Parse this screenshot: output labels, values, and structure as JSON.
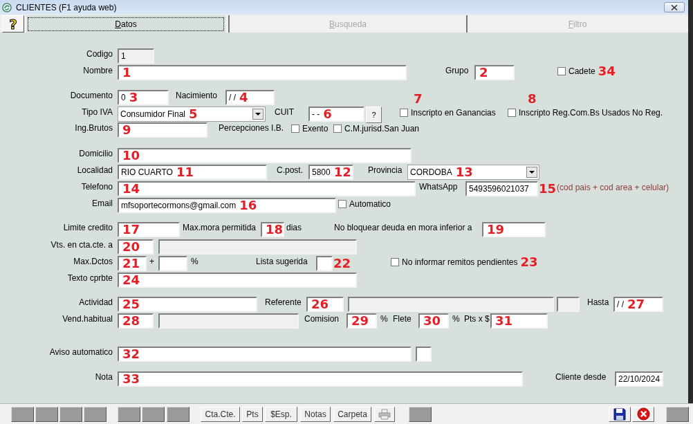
{
  "window": {
    "title": "CLIENTES (F1 ayuda web)"
  },
  "help_button": "?",
  "tabs": [
    {
      "label": "Datos",
      "selected": true,
      "disabled": false
    },
    {
      "label": "Busqueda",
      "selected": false,
      "disabled": true
    },
    {
      "label": "Filtro",
      "selected": false,
      "disabled": true
    }
  ],
  "rows": [
    {
      "items": [
        {
          "kind": "label",
          "text": "Codigo"
        },
        {
          "kind": "field",
          "value": "1",
          "readonly": true
        }
      ]
    },
    {
      "items": [
        {
          "kind": "label",
          "text": "Nombre"
        },
        {
          "kind": "field",
          "marker": "1",
          "readonly": false
        },
        {
          "kind": "label",
          "text": "Grupo"
        },
        {
          "kind": "field",
          "marker": "2",
          "readonly": false
        },
        {
          "kind": "checkbox",
          "text": "Cadete",
          "checked": false,
          "marker": "34"
        }
      ]
    },
    {
      "items": [
        {
          "kind": "label",
          "text": "Documento"
        },
        {
          "kind": "field",
          "marker": "3",
          "value": "0",
          "readonly": false
        },
        {
          "kind": "label",
          "text": "Nacimiento"
        },
        {
          "kind": "field",
          "value": "/ /",
          "marker": "4",
          "readonly": false
        }
      ]
    },
    {
      "items": [
        {
          "kind": "label",
          "text": "Tipo IVA"
        },
        {
          "kind": "select",
          "value": "Consumidor Final",
          "marker": "5"
        },
        {
          "kind": "label",
          "text": "CUIT"
        },
        {
          "kind": "field",
          "value": "- -",
          "marker": "6",
          "readonly": false
        },
        {
          "kind": "button",
          "text": "?"
        },
        {
          "kind": "checkbox",
          "text": "Inscripto en Ganancias",
          "checked": false,
          "marker_above": "7"
        },
        {
          "kind": "checkbox",
          "text": "Inscripto Reg.Com.Bs Usados No Reg.",
          "checked": false,
          "marker_above": "8"
        }
      ]
    },
    {
      "items": [
        {
          "kind": "label",
          "text": "Ing.Brutos"
        },
        {
          "kind": "field",
          "marker": "9",
          "readonly": false
        },
        {
          "kind": "label",
          "text": "Percepciones I.B."
        },
        {
          "kind": "checkbox",
          "text": "Exento",
          "checked": false
        },
        {
          "kind": "checkbox",
          "text": "C.M.jurisd.San Juan",
          "checked": false
        }
      ]
    },
    {
      "items": [
        {
          "kind": "label",
          "text": "Domicilio"
        },
        {
          "kind": "field",
          "marker": "10",
          "readonly": false
        }
      ]
    },
    {
      "items": [
        {
          "kind": "label",
          "text": "Localidad"
        },
        {
          "kind": "field",
          "value": "RIO CUARTO",
          "marker": "11",
          "readonly": false
        },
        {
          "kind": "label",
          "text": "C.post."
        },
        {
          "kind": "field",
          "value": "5800",
          "marker": "12",
          "readonly": false
        },
        {
          "kind": "label",
          "text": "Provincia"
        },
        {
          "kind": "select",
          "value": "CORDOBA",
          "marker": "13"
        }
      ]
    },
    {
      "items": [
        {
          "kind": "label",
          "text": "Telefono"
        },
        {
          "kind": "field",
          "marker": "14",
          "readonly": false
        },
        {
          "kind": "label",
          "text": "WhatsApp"
        },
        {
          "kind": "field",
          "value": "5493596021037",
          "marker": "15",
          "readonly": false
        },
        {
          "kind": "note",
          "text": "(cod pais + cod area + celular)"
        }
      ]
    },
    {
      "items": [
        {
          "kind": "label",
          "text": "Email"
        },
        {
          "kind": "field",
          "value": "mfsoportecormons@gmail.com",
          "marker": "16",
          "readonly": false
        },
        {
          "kind": "checkbox",
          "text": "Automatico",
          "checked": false
        }
      ]
    },
    {
      "items": [
        {
          "kind": "label",
          "text": "Limite credito"
        },
        {
          "kind": "field",
          "marker": "17",
          "readonly": false
        },
        {
          "kind": "label",
          "text": "Max.mora permitida"
        },
        {
          "kind": "field",
          "marker": "18",
          "readonly": false
        },
        {
          "kind": "label",
          "text": "dias"
        },
        {
          "kind": "label",
          "text": "No bloquear deuda en mora inferior a"
        },
        {
          "kind": "field",
          "marker": "19",
          "readonly": false
        }
      ]
    },
    {
      "items": [
        {
          "kind": "label",
          "text": "Vts. en cta.cte. a"
        },
        {
          "kind": "field",
          "marker": "20",
          "readonly": false
        },
        {
          "kind": "field",
          "readonly": true
        }
      ]
    },
    {
      "items": [
        {
          "kind": "label",
          "text": "Max.Dctos"
        },
        {
          "kind": "field",
          "marker": "21",
          "readonly": false
        },
        {
          "kind": "label",
          "text": "+"
        },
        {
          "kind": "field",
          "readonly": false
        },
        {
          "kind": "label",
          "text": "%"
        },
        {
          "kind": "label",
          "text": "Lista sugerida"
        },
        {
          "kind": "field",
          "marker": "22",
          "readonly": false
        },
        {
          "kind": "checkbox",
          "text": "No informar remitos pendientes",
          "checked": false,
          "marker": "23"
        }
      ]
    },
    {
      "items": [
        {
          "kind": "label",
          "text": "Texto cprbte"
        },
        {
          "kind": "field",
          "marker": "24",
          "readonly": false
        }
      ]
    },
    {
      "items": [
        {
          "kind": "label",
          "text": "Actividad"
        },
        {
          "kind": "field",
          "marker": "25",
          "readonly": false
        },
        {
          "kind": "label",
          "text": "Referente"
        },
        {
          "kind": "field",
          "marker": "26",
          "readonly": false
        },
        {
          "kind": "field",
          "readonly": true
        },
        {
          "kind": "field",
          "readonly": true
        },
        {
          "kind": "label",
          "text": "Hasta"
        },
        {
          "kind": "field",
          "value": "/ /",
          "marker": "27",
          "readonly": false
        }
      ]
    },
    {
      "items": [
        {
          "kind": "label",
          "text": "Vend.habitual"
        },
        {
          "kind": "field",
          "marker": "28",
          "readonly": false
        },
        {
          "kind": "field",
          "readonly": true
        },
        {
          "kind": "label",
          "text": "Comision"
        },
        {
          "kind": "field",
          "marker": "29",
          "readonly": false
        },
        {
          "kind": "label",
          "text": "%"
        },
        {
          "kind": "label",
          "text": "Flete"
        },
        {
          "kind": "field",
          "marker": "30",
          "readonly": false
        },
        {
          "kind": "label",
          "text": "%"
        },
        {
          "kind": "label",
          "text": "Pts x $"
        },
        {
          "kind": "field",
          "marker": "31",
          "readonly": false
        }
      ]
    },
    {
      "items": [
        {
          "kind": "label",
          "text": "Aviso automatico"
        },
        {
          "kind": "field",
          "marker": "32",
          "readonly": false
        },
        {
          "kind": "field",
          "readonly": false
        }
      ]
    },
    {
      "items": [
        {
          "kind": "label",
          "text": "Nota"
        },
        {
          "kind": "field",
          "marker": "33",
          "readonly": false
        },
        {
          "kind": "label",
          "text": "Cliente desde"
        },
        {
          "kind": "field",
          "value": "22/10/2024",
          "readonly": false
        }
      ]
    }
  ],
  "toolbar": [
    {
      "kind": "blank"
    },
    {
      "kind": "blank"
    },
    {
      "kind": "blank"
    },
    {
      "kind": "blank"
    },
    {
      "kind": "blank"
    },
    {
      "kind": "blank"
    },
    {
      "kind": "blank"
    },
    {
      "kind": "text",
      "label": "Cta.Cte."
    },
    {
      "kind": "text",
      "label": "Pts"
    },
    {
      "kind": "text",
      "label": "$Esp."
    },
    {
      "kind": "text",
      "label": "Notas"
    },
    {
      "kind": "text",
      "label": "Carpeta"
    },
    {
      "kind": "printer"
    },
    {
      "kind": "blank"
    },
    {
      "kind": "save"
    },
    {
      "kind": "cancel"
    },
    {
      "kind": "blank"
    }
  ]
}
